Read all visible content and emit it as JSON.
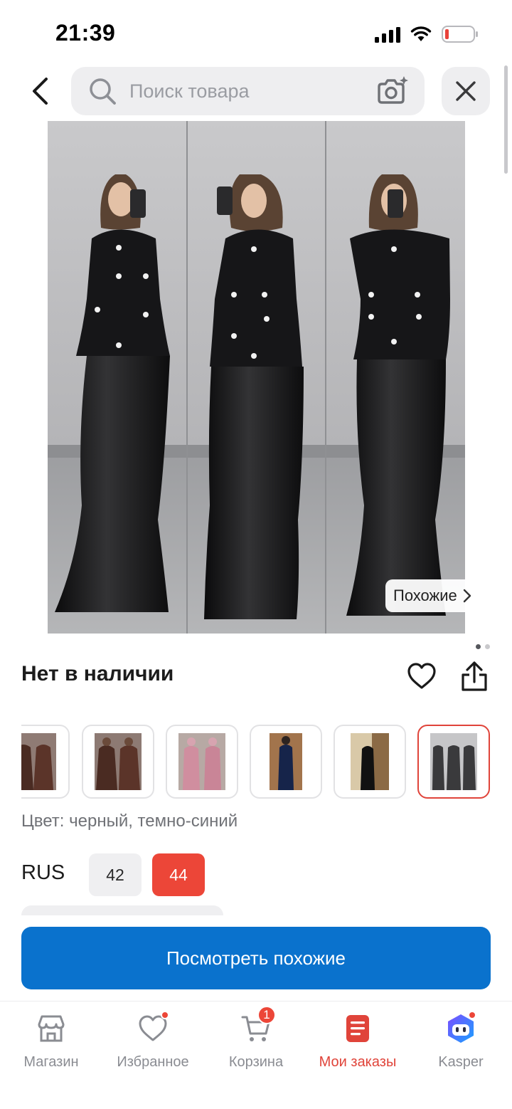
{
  "status_bar": {
    "time": "21:39",
    "icons": [
      "signal-icon",
      "wifi-icon",
      "battery-icon"
    ]
  },
  "header": {
    "back_icon": "chevron-left-icon",
    "search_placeholder": "Поиск товара",
    "camera_icon": "camera-search-icon",
    "close_icon": "close-icon"
  },
  "product": {
    "similar_label": "Похожие",
    "availability": "Нет в наличии",
    "image_page_count": 2,
    "image_page_active": 1,
    "variants": [
      {
        "name": "brown-suit",
        "selected": false
      },
      {
        "name": "brown-suit-2",
        "selected": false
      },
      {
        "name": "pink-dress",
        "selected": false
      },
      {
        "name": "navy-dress",
        "selected": false
      },
      {
        "name": "black-dress",
        "selected": false
      },
      {
        "name": "black-white-suit",
        "selected": true
      }
    ],
    "color_label": "Цвет: черный, темно-синий",
    "size_system": "RUS",
    "sizes": [
      {
        "label": "42",
        "selected": false
      },
      {
        "label": "44",
        "selected": true
      }
    ]
  },
  "cta": {
    "label": "Посмотреть похожие"
  },
  "bottom_nav": {
    "items": [
      {
        "label": "Магазин",
        "icon": "store-icon",
        "active": false
      },
      {
        "label": "Избранное",
        "icon": "heart-icon",
        "active": false,
        "dot": true
      },
      {
        "label": "Корзина",
        "icon": "cart-icon",
        "active": false,
        "badge": "1"
      },
      {
        "label": "Мои заказы",
        "icon": "orders-icon",
        "active": true
      },
      {
        "label": "Kasper",
        "icon": "kasper-icon",
        "active": false,
        "dot": true
      }
    ]
  },
  "colors": {
    "accent_red": "#ec4638",
    "cta_blue": "#0a72cd",
    "muted_text": "#8a8c92"
  }
}
